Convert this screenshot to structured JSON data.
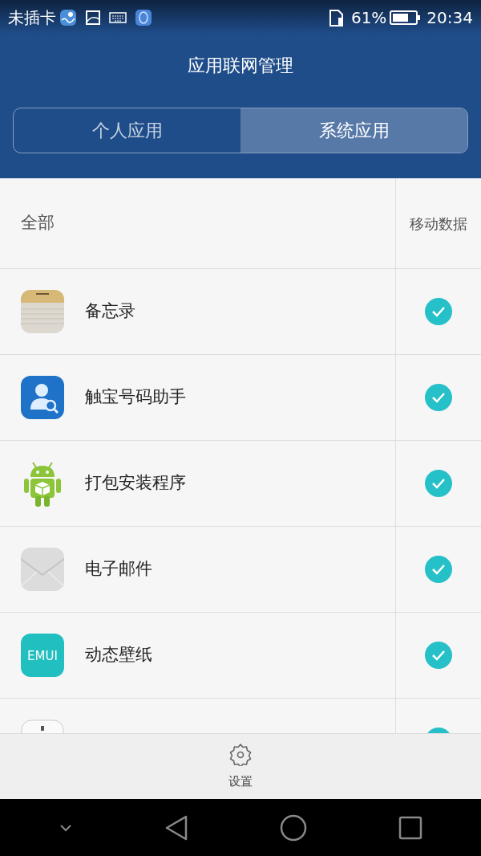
{
  "status_bar": {
    "carrier": "未插卡",
    "battery": "61%",
    "time": "20:34"
  },
  "title": "应用联网管理",
  "tabs": [
    {
      "label": "个人应用",
      "selected": false
    },
    {
      "label": "系统应用",
      "selected": true
    }
  ],
  "list_header": {
    "label": "全部",
    "column": "移动数据"
  },
  "apps": [
    {
      "kind": "notes",
      "name": "备忘录",
      "checked": true
    },
    {
      "kind": "contacts",
      "name": "触宝号码助手",
      "checked": true
    },
    {
      "kind": "android",
      "name": "打包安装程序",
      "checked": true
    },
    {
      "kind": "mail",
      "name": "电子邮件",
      "checked": true
    },
    {
      "kind": "emui",
      "name": "动态壁纸",
      "icon_text": "EMUI",
      "checked": true
    },
    {
      "kind": "app",
      "checked": true
    }
  ],
  "bottom_action": {
    "label": "设置"
  }
}
